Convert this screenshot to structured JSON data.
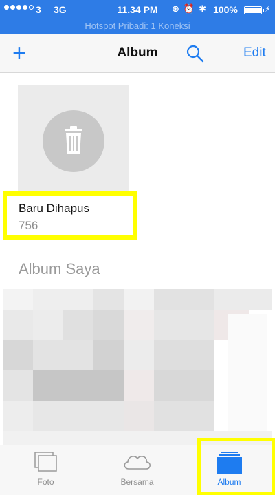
{
  "status_bar": {
    "carrier": "3",
    "network": "3G",
    "time": "11.34 PM",
    "battery_percent": "100%",
    "hotspot_banner": "Hotspot Pribadi: 1 Koneksi"
  },
  "nav": {
    "title": "Album",
    "edit_label": "Edit"
  },
  "recently_deleted": {
    "name": "Baru Dihapus",
    "count": "756"
  },
  "my_albums": {
    "section_title": "Album Saya"
  },
  "tab_bar": {
    "tabs": [
      {
        "label": "Foto",
        "active": false
      },
      {
        "label": "Bersama",
        "active": false
      },
      {
        "label": "Album",
        "active": true
      }
    ]
  },
  "colors": {
    "accent": "#1e7cf0",
    "status_bar": "#2e7ce6",
    "highlight": "#ffff00"
  }
}
